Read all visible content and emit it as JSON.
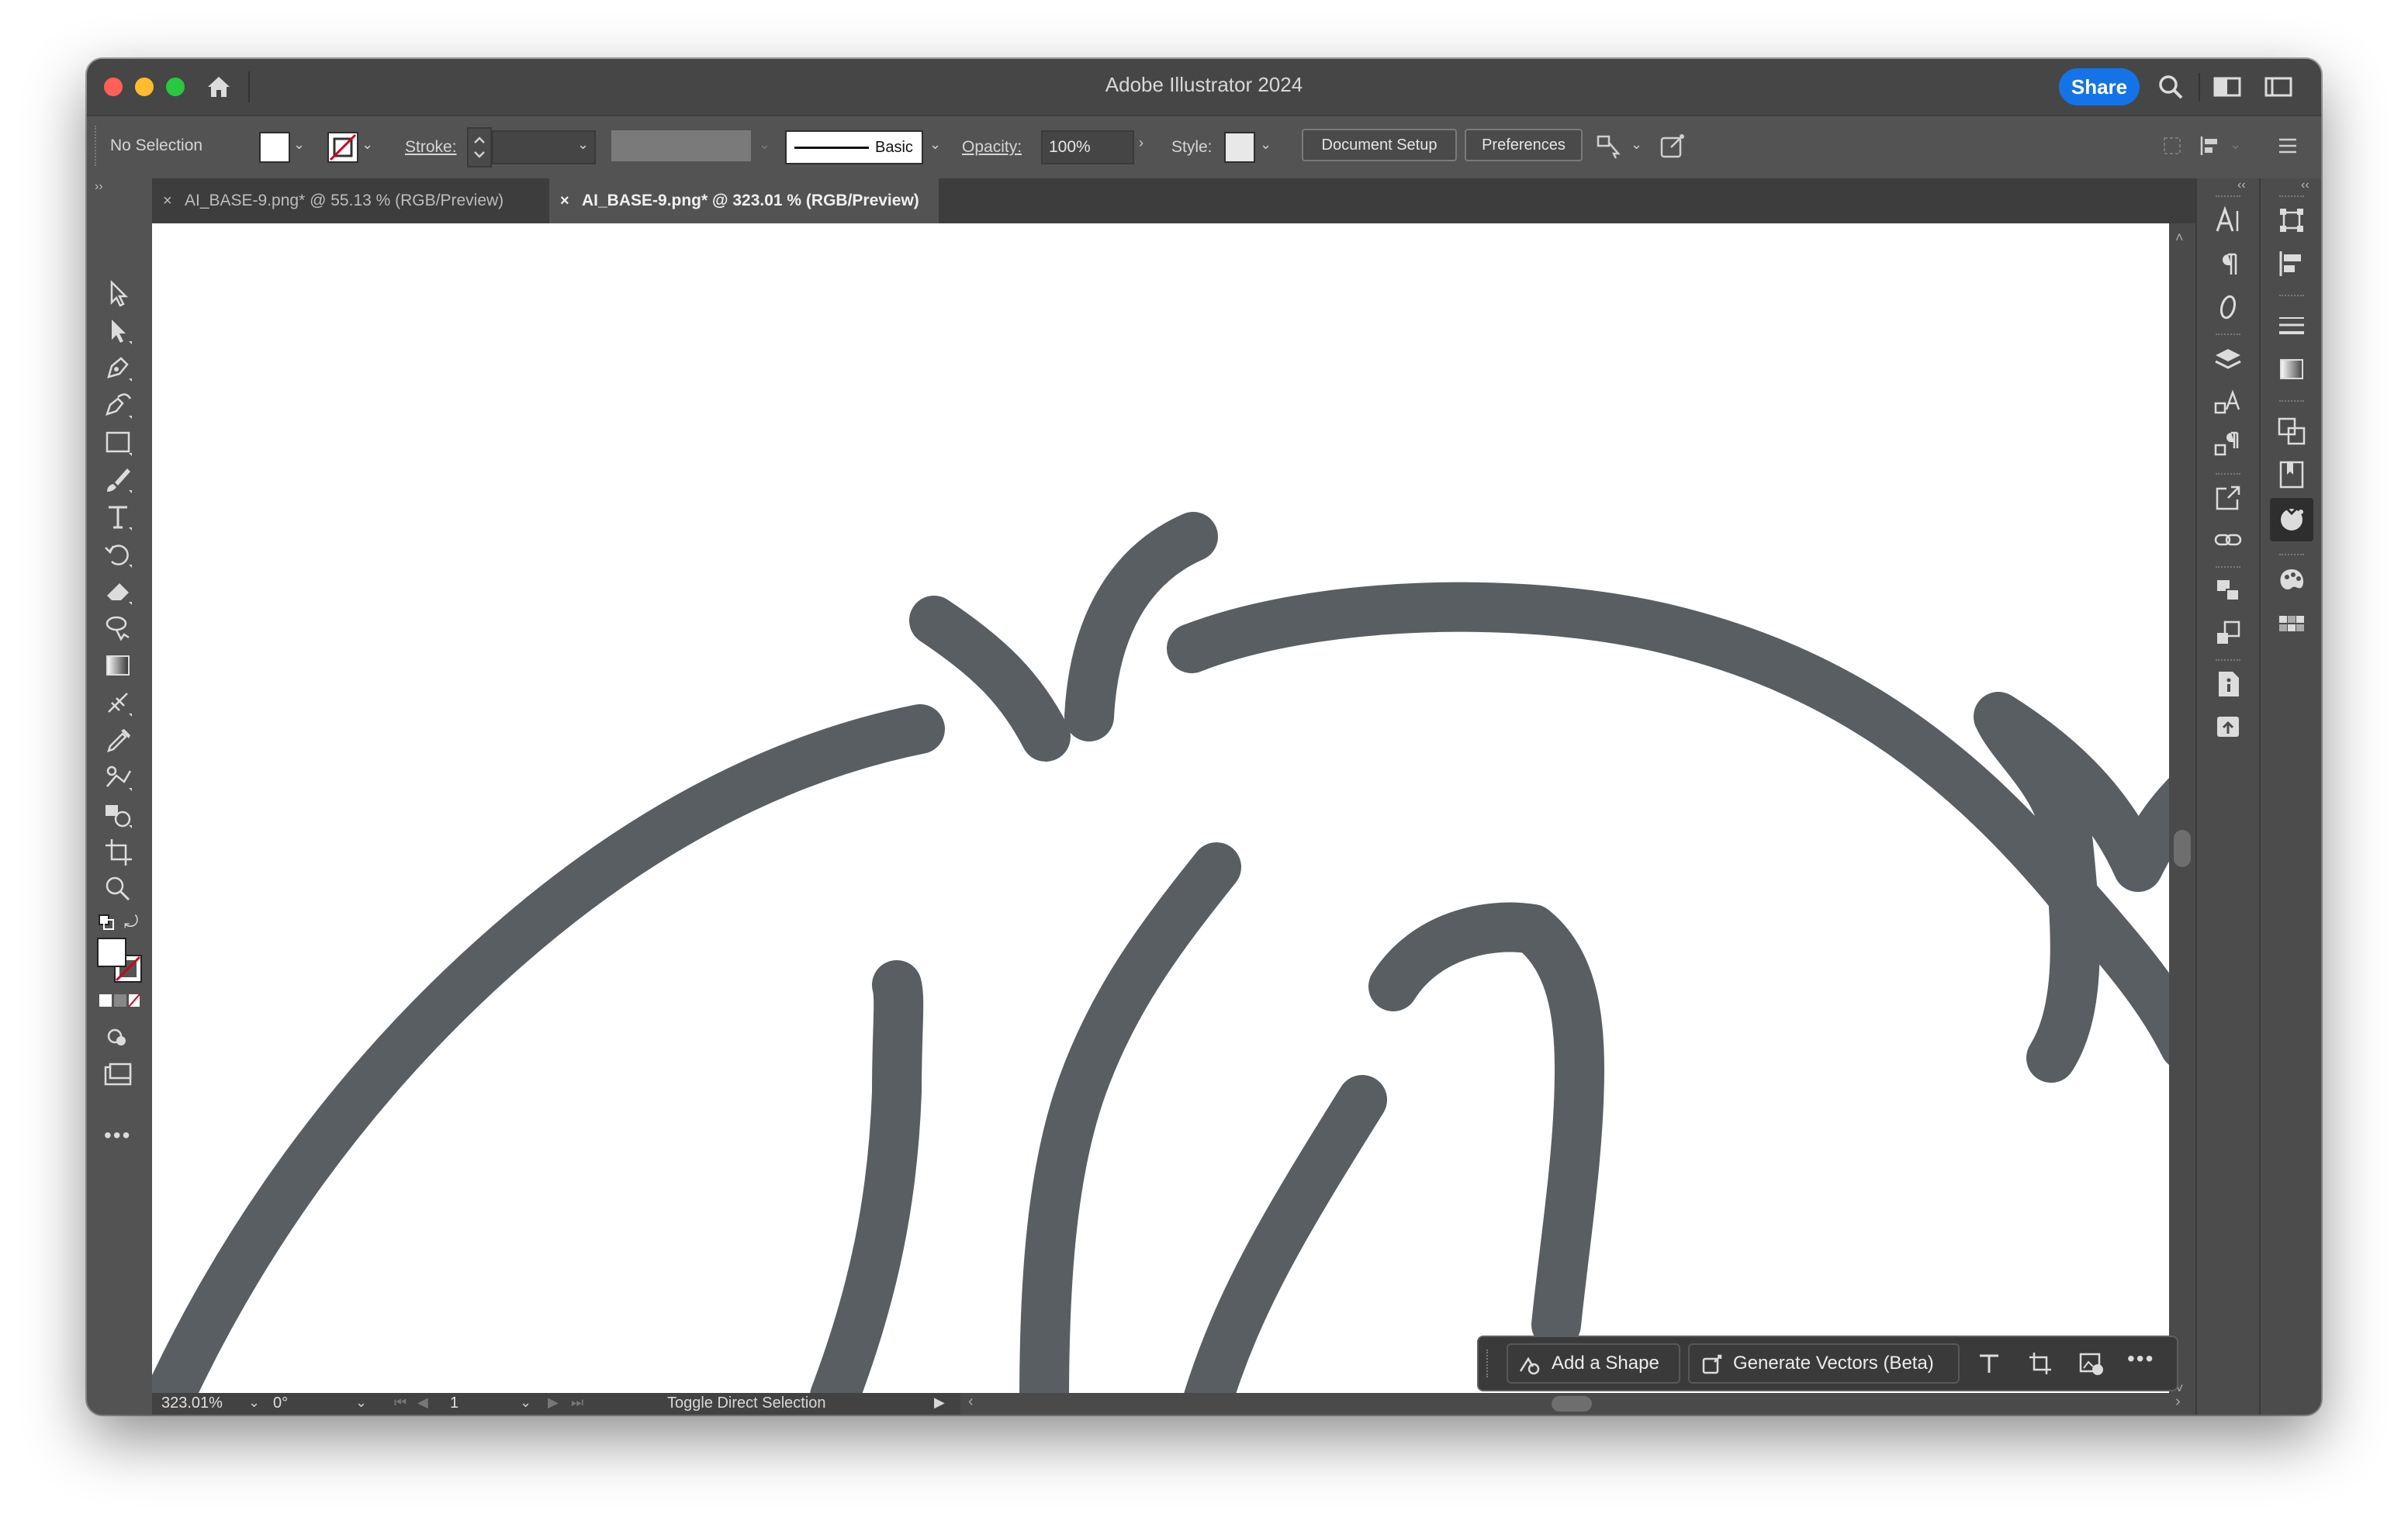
{
  "window": {
    "title": "Adobe Illustrator 2024",
    "share_label": "Share",
    "traffic_lights": {
      "close": "#ff5f57",
      "minimize": "#febc2e",
      "zoom": "#28c840"
    }
  },
  "control_bar": {
    "selection_label": "No Selection",
    "stroke_label": "Stroke:",
    "brush_label": "Basic",
    "opacity_label": "Opacity:",
    "opacity_value": "100%",
    "style_label": "Style:",
    "document_setup_label": "Document Setup",
    "preferences_label": "Preferences"
  },
  "tabs": [
    {
      "label": "AI_BASE-9.png* @ 55.13 % (RGB/Preview)",
      "active": false
    },
    {
      "label": "AI_BASE-9.png* @ 323.01 % (RGB/Preview)",
      "active": true
    }
  ],
  "status_bar": {
    "zoom": "323.01%",
    "rotation": "0°",
    "artboard": "1",
    "info": "Toggle Direct Selection"
  },
  "task_bar": {
    "add_shape_label": "Add a Shape",
    "generate_label": "Generate Vectors (Beta)"
  },
  "colors": {
    "stroke_art": "#595e63",
    "accent": "#1473e6",
    "ui_bg": "#535353"
  }
}
